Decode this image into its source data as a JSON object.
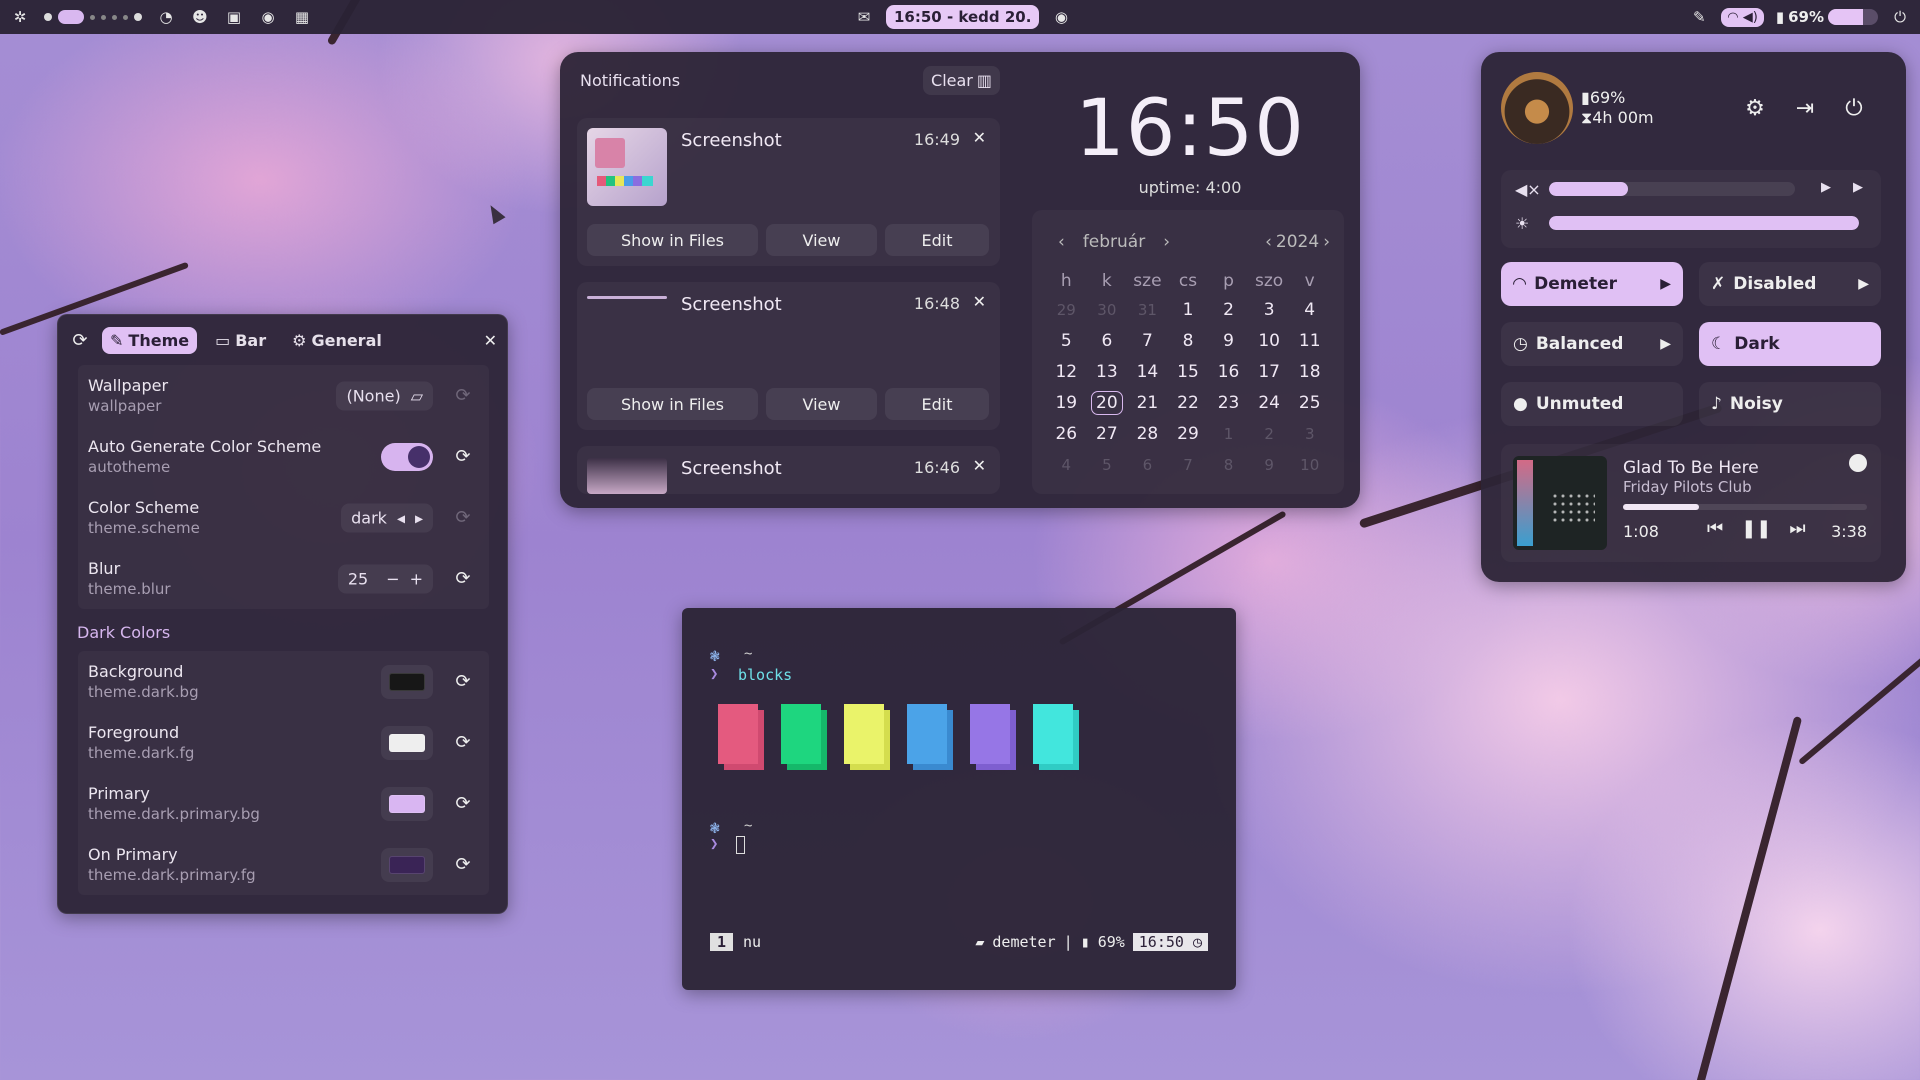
{
  "topbar": {
    "clock": "16:50 - kedd 20.",
    "battery": "69%",
    "battery_level": 0.69
  },
  "settings": {
    "tabs": [
      {
        "label": "Theme",
        "icon": "palette-icon",
        "active": true
      },
      {
        "label": "Bar",
        "icon": "bar-icon",
        "active": false
      },
      {
        "label": "General",
        "icon": "gear-icon",
        "active": false
      }
    ],
    "rows": [
      {
        "title": "Wallpaper",
        "key": "wallpaper",
        "value": "(None)"
      },
      {
        "title": "Auto Generate Color Scheme",
        "key": "autotheme",
        "value": true
      },
      {
        "title": "Color Scheme",
        "key": "theme.scheme",
        "value": "dark"
      },
      {
        "title": "Blur",
        "key": "theme.blur",
        "value": "25"
      }
    ],
    "section": "Dark Colors",
    "colors": [
      {
        "title": "Background",
        "key": "theme.dark.bg",
        "color": "#171717"
      },
      {
        "title": "Foreground",
        "key": "theme.dark.fg",
        "color": "#eeeeee"
      },
      {
        "title": "Primary",
        "key": "theme.dark.primary.bg",
        "color": "#d9b6f2"
      },
      {
        "title": "On Primary",
        "key": "theme.dark.primary.fg",
        "color": "#3a2456"
      }
    ]
  },
  "notifications": {
    "title": "Notifications",
    "clear_label": "Clear",
    "items": [
      {
        "title": "Screenshot",
        "time": "16:49",
        "actions": [
          "Show in Files",
          "View",
          "Edit"
        ]
      },
      {
        "title": "Screenshot",
        "time": "16:48",
        "actions": [
          "Show in Files",
          "View",
          "Edit"
        ]
      },
      {
        "title": "Screenshot",
        "time": "16:46"
      }
    ]
  },
  "clock": {
    "time": "16:50",
    "uptime": "uptime: 4:00"
  },
  "calendar": {
    "month": "február",
    "year": "2024",
    "weekdays": [
      "h",
      "k",
      "sze",
      "cs",
      "p",
      "szo",
      "v"
    ],
    "days": [
      [
        "29",
        "30",
        "31",
        "1",
        "2",
        "3",
        "4"
      ],
      [
        "5",
        "6",
        "7",
        "8",
        "9",
        "10",
        "11"
      ],
      [
        "12",
        "13",
        "14",
        "15",
        "16",
        "17",
        "18"
      ],
      [
        "19",
        "20",
        "21",
        "22",
        "23",
        "24",
        "25"
      ],
      [
        "26",
        "27",
        "28",
        "29",
        "1",
        "2",
        "3"
      ],
      [
        "4",
        "5",
        "6",
        "7",
        "8",
        "9",
        "10"
      ]
    ],
    "today": "20"
  },
  "quick_settings": {
    "battery": "69%",
    "time_left": "4h 00m",
    "volume": 0.32,
    "brightness": 1.0,
    "toggles": [
      {
        "label": "Demeter",
        "icon": "wifi-icon",
        "on": true,
        "arrow": true
      },
      {
        "label": "Disabled",
        "icon": "bluetooth-off-icon",
        "on": false,
        "arrow": true
      },
      {
        "label": "Balanced",
        "icon": "power-profile-icon",
        "on": false,
        "arrow": true
      },
      {
        "label": "Dark",
        "icon": "moon-icon",
        "on": true,
        "arrow": false
      },
      {
        "label": "Unmuted",
        "icon": "microphone-icon",
        "on": false,
        "arrow": false
      },
      {
        "label": "Noisy",
        "icon": "bell-icon",
        "on": false,
        "arrow": false
      }
    ],
    "media": {
      "title": "Glad To Be Here",
      "artist": "Friday Pilots Club",
      "current": "1:08",
      "total": "3:38",
      "progress": 0.31
    }
  },
  "terminal": {
    "prompt_dir": "~",
    "command": "blocks",
    "block_colors": [
      {
        "front": "#e45a7f",
        "back": "#d04a70"
      },
      {
        "front": "#1ed67f",
        "back": "#15b86a"
      },
      {
        "front": "#eaf36a",
        "back": "#d4dd4e"
      },
      {
        "front": "#4ba3e8",
        "back": "#3a8ad0"
      },
      {
        "front": "#9676e6",
        "back": "#7e5fd0"
      },
      {
        "front": "#42e6dd",
        "back": "#30ccc4"
      }
    ],
    "status": {
      "workspace": "1",
      "shell": "nu",
      "dir": "demeter",
      "battery": "69%",
      "time": "16:50"
    }
  }
}
